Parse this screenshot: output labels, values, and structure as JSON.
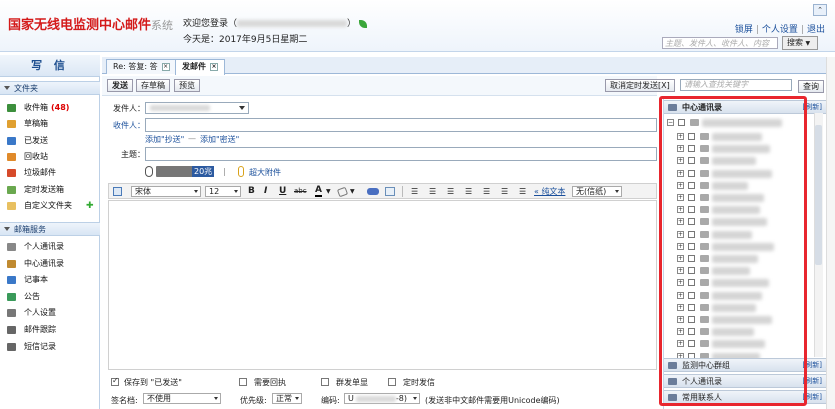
{
  "header": {
    "logo_main": "国家无线电监测中心邮件",
    "logo_sys": "系统",
    "welcome_prefix": "欢迎您登录（",
    "welcome_suffix": "）",
    "today_label": "今天是：2017年9月5日星期二",
    "links": [
      "锁屏",
      "个人设置",
      "退出"
    ],
    "search_placeholder": "主题、发件人、收件人、内容",
    "search_button": "搜索"
  },
  "sidebar": {
    "write_label": "写 信",
    "folders_title": "文件夹",
    "folders": [
      {
        "label": "收件箱",
        "badge": "(48)",
        "icon": "inbox-icon",
        "color": "#3c8f3c"
      },
      {
        "label": "草稿箱",
        "icon": "drafts-icon",
        "color": "#e0a030"
      },
      {
        "label": "已发送",
        "icon": "sent-icon",
        "color": "#3a78c8"
      },
      {
        "label": "回收站",
        "icon": "trash-icon",
        "color": "#e08a2a"
      },
      {
        "label": "垃圾邮件",
        "icon": "spam-icon",
        "color": "#d64a2a"
      },
      {
        "label": "定时发送箱",
        "icon": "scheduled-icon",
        "color": "#6aa84f"
      },
      {
        "label": "自定义文件夹",
        "icon": "custom-folder-icon",
        "color": "#e8c060"
      }
    ],
    "services_title": "邮箱服务",
    "services": [
      {
        "label": "个人通讯录",
        "icon": "personal-contacts-icon",
        "color": "#888888"
      },
      {
        "label": "中心通讯录",
        "icon": "center-contacts-icon",
        "color": "#c08a30"
      },
      {
        "label": "记事本",
        "icon": "notepad-icon",
        "color": "#3a78c8"
      },
      {
        "label": "公告",
        "icon": "announcement-icon",
        "color": "#3a9a5a"
      },
      {
        "label": "个人设置",
        "icon": "settings-icon",
        "color": "#777777"
      },
      {
        "label": "邮件跟踪",
        "icon": "mail-track-icon",
        "color": "#666666"
      },
      {
        "label": "短信记录",
        "icon": "sms-icon",
        "color": "#666666"
      }
    ]
  },
  "tabs": [
    {
      "label": "Re: 答复: 答",
      "active": false
    },
    {
      "label": "发邮件",
      "active": true
    }
  ],
  "toolbar": {
    "send": "发送",
    "save_draft": "存草稿",
    "preview": "预览",
    "cancel_scheduled": "取消定时发送[X]",
    "addr_search_placeholder": "请输入查找关键字",
    "addr_search_button": "查询"
  },
  "compose": {
    "from_label": "发件人：",
    "to_label": "收件人：",
    "add_cc": "添加\"抄送\"",
    "dash": "—",
    "add_bcc": "添加\"密送\"",
    "subject_label": "主题：",
    "attach_size": "20兆",
    "attach_sep": "|",
    "large_attach": "超大附件"
  },
  "editor": {
    "font": "宋体",
    "size": "12",
    "bold": "B",
    "italic": "I",
    "underline": "U",
    "strike": "abc",
    "color": "A",
    "plain_text": "« 纯文本",
    "format": "无(信纸)"
  },
  "options": {
    "save_sent": "保存到 \"已发送\"",
    "need_receipt": "需要回执",
    "group_single": "群发单显",
    "scheduled": "定时发信",
    "signature_label": "签名档:",
    "signature_value": "不使用",
    "priority_label": "优先级:",
    "priority_value": "正常",
    "encoding_label": "编码:",
    "encoding_value": "U",
    "encoding_suffix": "-8)",
    "encoding_note": "(发送非中文邮件需要用Unicode编码)"
  },
  "addressbook": {
    "center_title": "中心通讯录",
    "refresh": "[刷新]",
    "groups_title": "监测中心群组",
    "personal_title": "个人通讯录",
    "frequent_title": "常用联系人"
  }
}
